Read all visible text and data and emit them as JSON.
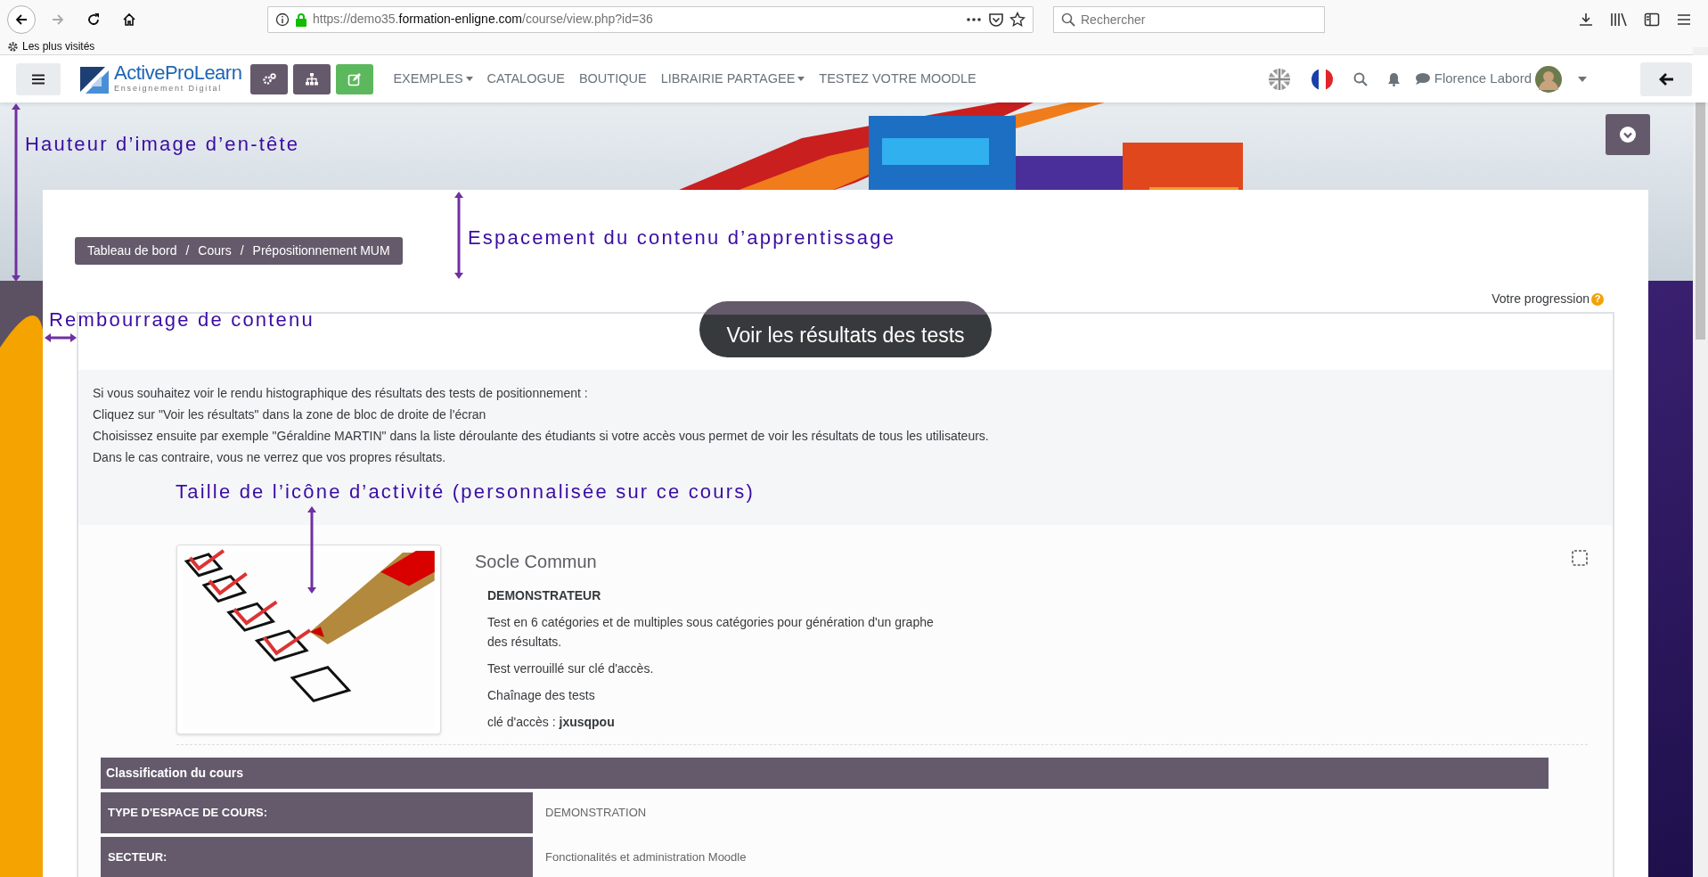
{
  "browser": {
    "url_scheme": "https://demo35.",
    "url_domain": "formation-enligne.com",
    "url_path": "/course/view.php?id=36",
    "search_placeholder": "Rechercher",
    "bookmarks": [
      {
        "label": "Les plus visités"
      }
    ]
  },
  "navbar": {
    "logo": {
      "name": "ActiveProLearn",
      "tagline": "Enseignement Digital"
    },
    "action_buttons": [
      {
        "kind": "gears",
        "color": "#645a6b"
      },
      {
        "kind": "sitemap",
        "color": "#645a6b"
      },
      {
        "kind": "edit",
        "color": "#5cb85c"
      }
    ],
    "menu": [
      {
        "label": "EXEMPLES",
        "dropdown": true
      },
      {
        "label": "CATALOGUE",
        "dropdown": false
      },
      {
        "label": "BOUTIQUE",
        "dropdown": false
      },
      {
        "label": "LIBRAIRIE PARTAGEE",
        "dropdown": true
      },
      {
        "label": "TESTEZ VOTRE MOODLE",
        "dropdown": false
      }
    ],
    "user": {
      "name": "Florence Labord"
    }
  },
  "annotations": [
    {
      "text": "Hauteur d’image d’en-tête"
    },
    {
      "text": "Espacement du contenu d’apprentissage"
    },
    {
      "text": "Rembourrage de contenu"
    },
    {
      "text": "Taille de l’icône d’activité (personnalisée sur ce cours)"
    }
  ],
  "breadcrumb": {
    "separator": "/",
    "items": [
      "Tableau de bord",
      "Cours",
      "Prépositionnement MUM"
    ]
  },
  "progress": {
    "label": "Votre progression",
    "help": "?"
  },
  "section": {
    "title": "Voir les résultats des tests",
    "summary": [
      "Si vous souhaitez voir le rendu histographique des résultats des tests de positionnement :",
      "Cliquez sur \"Voir les résultats\" dans la zone de bloc de  droite de l'écran",
      "Choisissez ensuite par exemple  \"Géraldine MARTIN\" dans la liste déroulante des étudiants si votre accès vous permet de voir les résultats de tous les utilisateurs.",
      "Dans le cas contraire, vous ne verrez que vos propres résultats."
    ],
    "activity": {
      "title": "Socle Commun",
      "heading": "DEMONSTRATEUR",
      "lines": [
        "Test en 6 catégories et de multiples sous catégories pour génération d'un graphe des résultats.",
        "Test verrouillé sur clé d'accès.",
        "Chaînage des tests",
        "clé d'accès : **jxusqpou**"
      ]
    },
    "classification": {
      "title": "Classification du cours",
      "rows": [
        {
          "label": "TYPE D'ESPACE DE COURS:",
          "value": "DEMONSTRATION"
        },
        {
          "label": "SECTEUR:",
          "value": "Fonctionalités et administration Moodle"
        }
      ]
    }
  }
}
